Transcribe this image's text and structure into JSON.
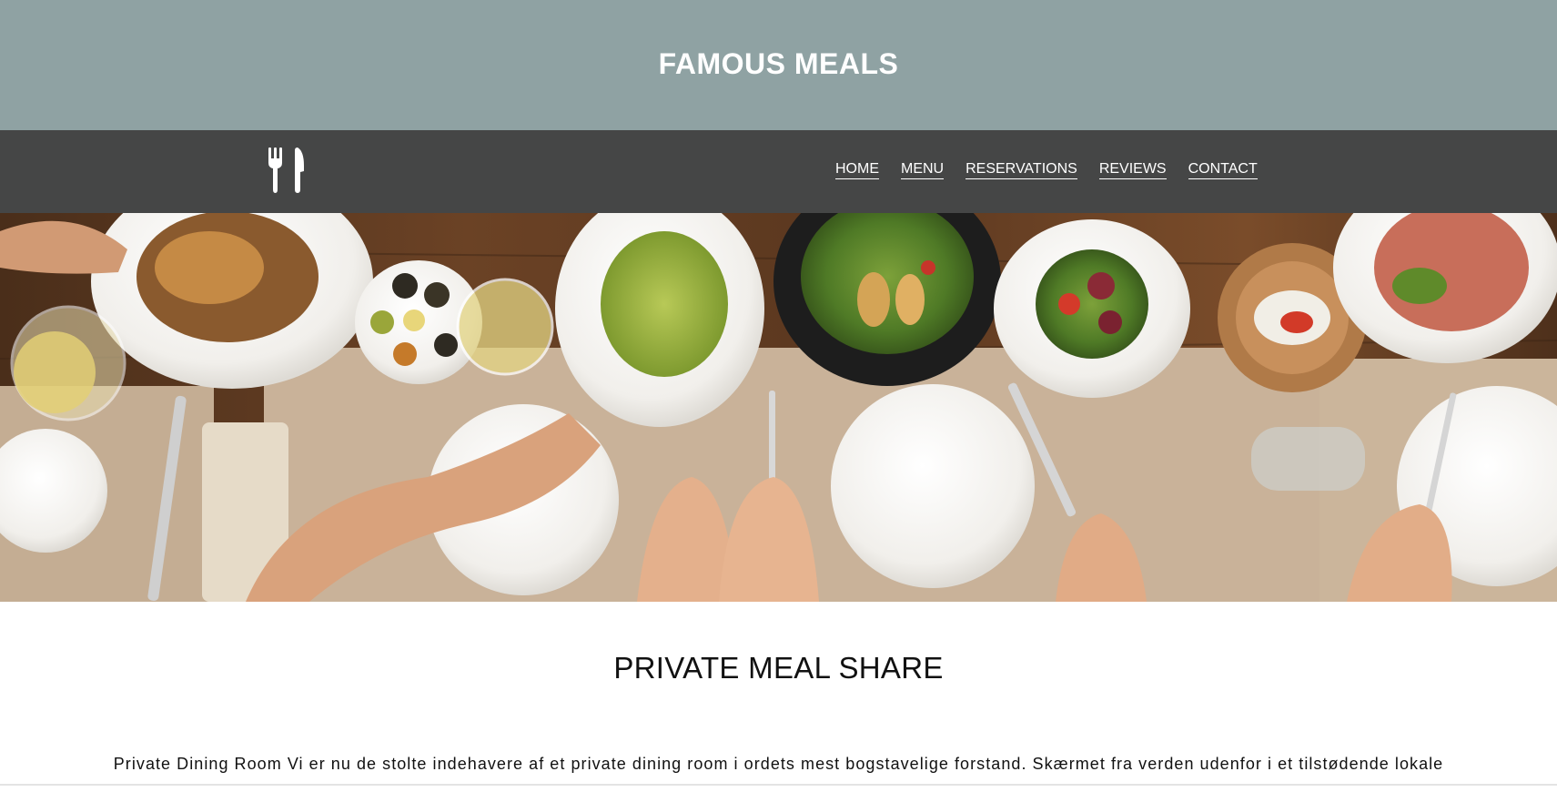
{
  "header": {
    "title": "FAMOUS MEALS",
    "background_color": "#8fa2a3"
  },
  "nav": {
    "background_color": "#454646",
    "logo_icon": "fork-knife-icon",
    "items": [
      {
        "label": "HOME"
      },
      {
        "label": "MENU"
      },
      {
        "label": "RESERVATIONS"
      },
      {
        "label": "REVIEWS"
      },
      {
        "label": "CONTACT"
      }
    ]
  },
  "hero": {
    "image": "overhead-dining-table-photo"
  },
  "main": {
    "heading": "PRIVATE MEAL SHARE",
    "intro": "Private Dining Room Vi er nu de stolte indehavere af et private dining room i ordets mest bogstavelige forstand. Skærmet fra verden udenfor i et tilstødende lokale"
  }
}
